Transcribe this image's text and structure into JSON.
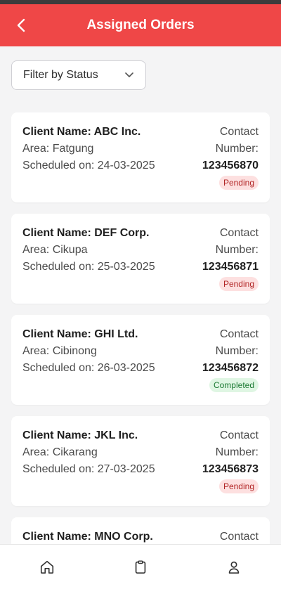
{
  "header": {
    "title": "Assigned Orders"
  },
  "filter": {
    "label": "Filter by Status"
  },
  "orders": [
    {
      "client": "Client Name: ABC Inc.",
      "area": "Area: Fatgung",
      "scheduled": "Scheduled on: 24-03-2025",
      "contact_label": "Contact Number:",
      "phone": "123456870",
      "status": "Pending"
    },
    {
      "client": "Client Name: DEF Corp.",
      "area": "Area: Cikupa",
      "scheduled": "Scheduled on: 25-03-2025",
      "contact_label": "Contact Number:",
      "phone": "123456871",
      "status": "Pending"
    },
    {
      "client": "Client Name: GHI Ltd.",
      "area": "Area: Cibinong",
      "scheduled": "Scheduled on: 26-03-2025",
      "contact_label": "Contact Number:",
      "phone": "123456872",
      "status": "Completed"
    },
    {
      "client": "Client Name: JKL Inc.",
      "area": "Area: Cikarang",
      "scheduled": "Scheduled on: 27-03-2025",
      "contact_label": "Contact Number:",
      "phone": "123456873",
      "status": "Pending"
    },
    {
      "client": "Client Name: MNO Corp.",
      "area": "",
      "scheduled": "",
      "contact_label": "Contact",
      "phone": "",
      "status": ""
    }
  ],
  "nav": {
    "items": [
      "home-icon",
      "clipboard-icon",
      "profile-icon"
    ]
  },
  "colors": {
    "primary": "#ef4747",
    "pending_bg": "#fde0e0",
    "pending_text": "#b12525",
    "completed_bg": "#dff6e3",
    "completed_text": "#1c7a33"
  }
}
